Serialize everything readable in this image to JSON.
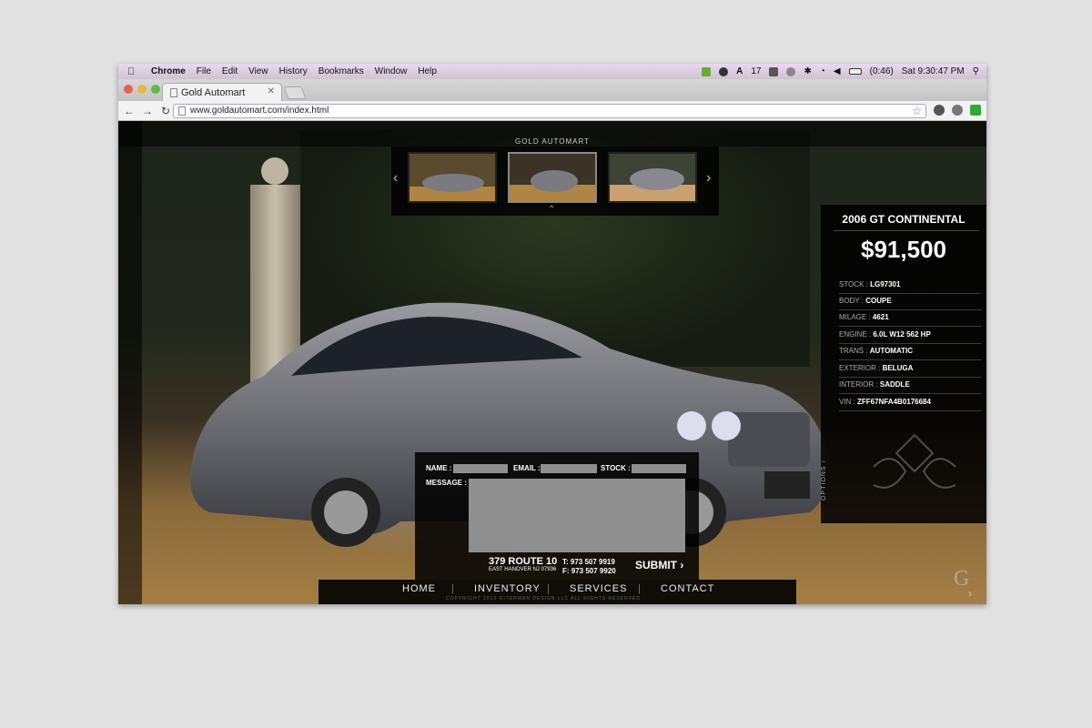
{
  "menubar": {
    "app": "Chrome",
    "items": [
      "File",
      "Edit",
      "View",
      "History",
      "Bookmarks",
      "Window",
      "Help"
    ],
    "status_count": "17",
    "battery": "(0:46)",
    "clock": "Sat 9:30:47 PM"
  },
  "browser": {
    "tab_title": "Gold Automart",
    "url": "www.goldautomart.com/index.html"
  },
  "site": {
    "logo_text": "GOLD AUTOMART",
    "car_title": "2006 GT CONTINENTAL",
    "price": "$91,500",
    "specs": [
      {
        "label": "STOCK : ",
        "value": "LG97301"
      },
      {
        "label": "BODY : ",
        "value": "COUPE"
      },
      {
        "label": "MILAGE : ",
        "value": "4621"
      },
      {
        "label": "ENGINE : ",
        "value": "6.0L W12 562 HP"
      },
      {
        "label": "TRANS : ",
        "value": "AUTOMATIC"
      },
      {
        "label": "EXTERIOR : ",
        "value": "BELUGA"
      },
      {
        "label": "INTERIOR : ",
        "value": "SADDLE"
      },
      {
        "label": "VIN : ",
        "value": "ZFF67NFA4B0176684"
      }
    ],
    "options_label": "OPTIONS",
    "form": {
      "name_label": "NAME :",
      "email_label": "EMAIL :",
      "stock_label": "STOCK :",
      "message_label": "MESSAGE :",
      "submit": "SUBMIT"
    },
    "address_line1": "379 ROUTE 10",
    "address_line2": "EAST HANOVER NJ 07936",
    "phone": "T: 973 507 9919",
    "fax": "F: 973 507 9920",
    "nav": [
      "HOME",
      "INVENTORY",
      "SERVICES",
      "CONTACT"
    ],
    "copyright": "COPYRIGHT 2013 GITERMAN DESIGN LLC ALL RIGHTS RESERVED"
  },
  "colors": {
    "car": "#6f7076",
    "panel": "#000000",
    "field": "#8f8f8f"
  }
}
